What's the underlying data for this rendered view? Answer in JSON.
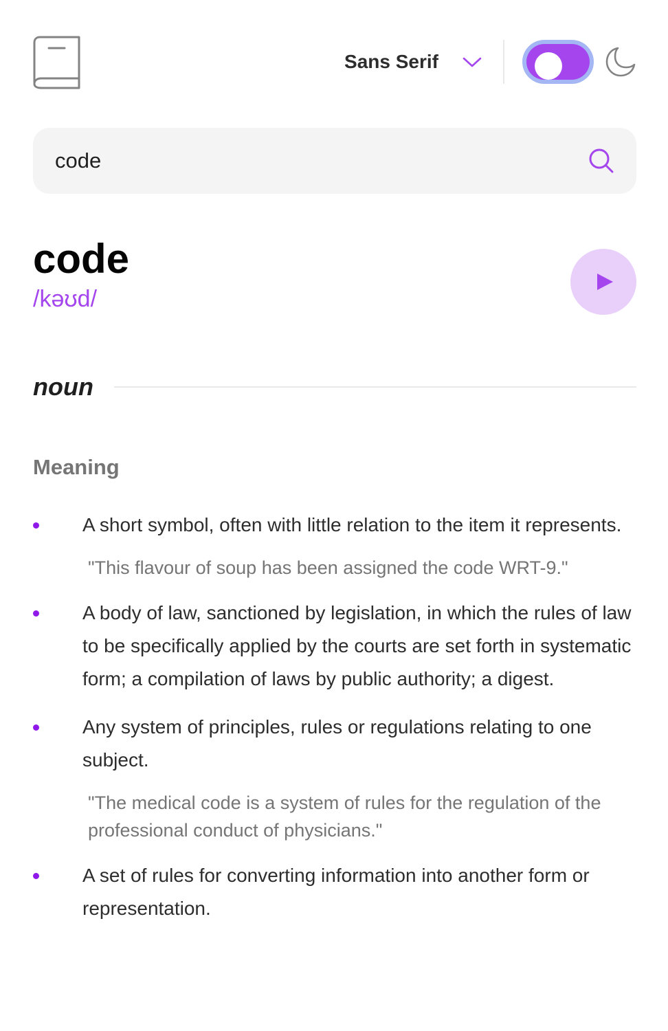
{
  "header": {
    "font_selector": {
      "label": "Sans Serif"
    },
    "theme_toggle": {
      "state": "on"
    },
    "colors": {
      "accent": "#a445ed",
      "toggle_ring": "#a4b6f4"
    }
  },
  "search": {
    "value": "code"
  },
  "entry": {
    "word": "code",
    "phonetic": "/kəʊd/",
    "part_of_speech": "noun",
    "meaning_heading": "Meaning",
    "definitions": [
      {
        "text": "A short symbol, often with little relation to the item it represents.",
        "example": "\"This flavour of soup has been assigned the code WRT-9.\""
      },
      {
        "text": "A body of law, sanctioned by legislation, in which the rules of law to be specifically applied by the courts are set forth in systematic form; a compilation of laws by public authority; a digest."
      },
      {
        "text": "Any system of principles, rules or regulations relating to one subject.",
        "example": "\"The medical code is a system of rules for the regulation of the professional conduct of physicians.\""
      },
      {
        "text": "A set of rules for converting information into another form or representation."
      }
    ]
  }
}
